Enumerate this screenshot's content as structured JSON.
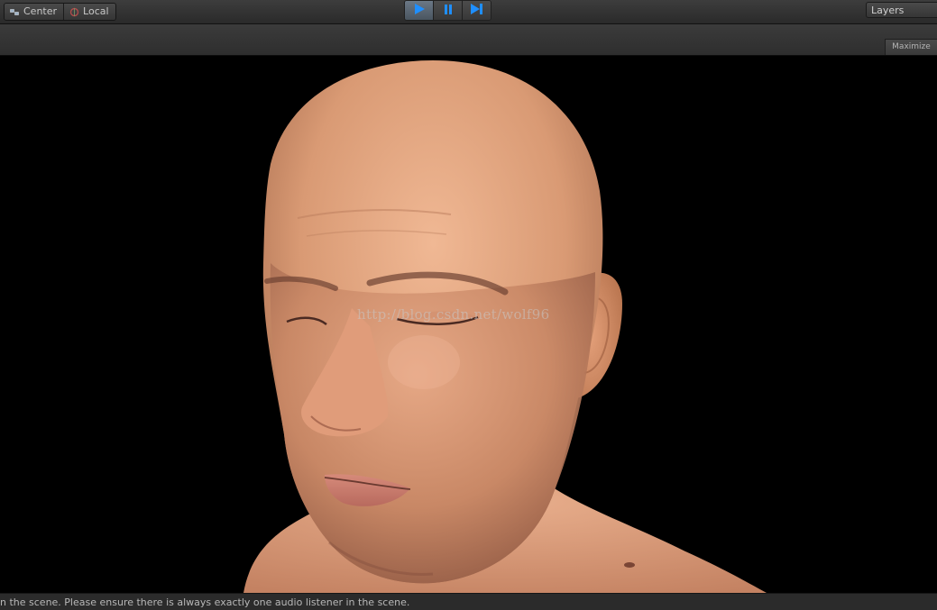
{
  "toolbar": {
    "pivot_center_label": "Center",
    "pivot_local_label": "Local",
    "layers_label": "Layers",
    "play_active": "play",
    "accent_color": "#1f8fff"
  },
  "game_view": {
    "maximize_label": "Maximize",
    "watermark_text": "http://blog.csdn.net/wolf96",
    "background_color": "#000000"
  },
  "status_bar": {
    "message": "n the scene. Please ensure there is always exactly one audio listener in the scene."
  },
  "icons": {
    "center": "pivot-center-icon",
    "local": "pivot-local-icon",
    "play": "play-icon",
    "pause": "pause-icon",
    "step": "step-icon"
  }
}
